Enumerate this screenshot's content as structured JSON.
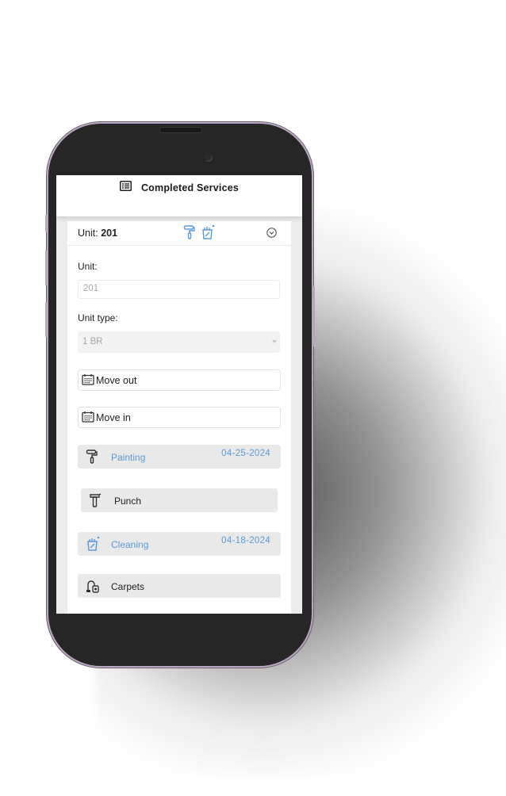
{
  "header": {
    "icon": "list-icon",
    "title": "Completed Services"
  },
  "unit_card": {
    "label": "Unit:",
    "number": "201",
    "status_icons": [
      "paint-roller-icon",
      "cleaning-icon"
    ],
    "toggle_icon": "chevron-down-circle-icon"
  },
  "form": {
    "unit_label": "Unit:",
    "unit_value": "201",
    "unit_type_label": "Unit type:",
    "unit_type_value": "1 BR",
    "move_out_label": "Move out",
    "move_in_label": "Move in"
  },
  "services": [
    {
      "name": "Painting",
      "icon": "paint-roller-icon",
      "date": "04-25-2024",
      "completed": true,
      "color": "#5a9bd6"
    },
    {
      "name": "Punch",
      "icon": "hammer-icon",
      "date": "",
      "completed": false
    },
    {
      "name": "Cleaning",
      "icon": "cleaning-icon",
      "date": "04-18-2024",
      "completed": true,
      "color": "#5a9bd6"
    },
    {
      "name": "Carpets",
      "icon": "vacuum-icon",
      "date": "",
      "completed": false
    }
  ]
}
